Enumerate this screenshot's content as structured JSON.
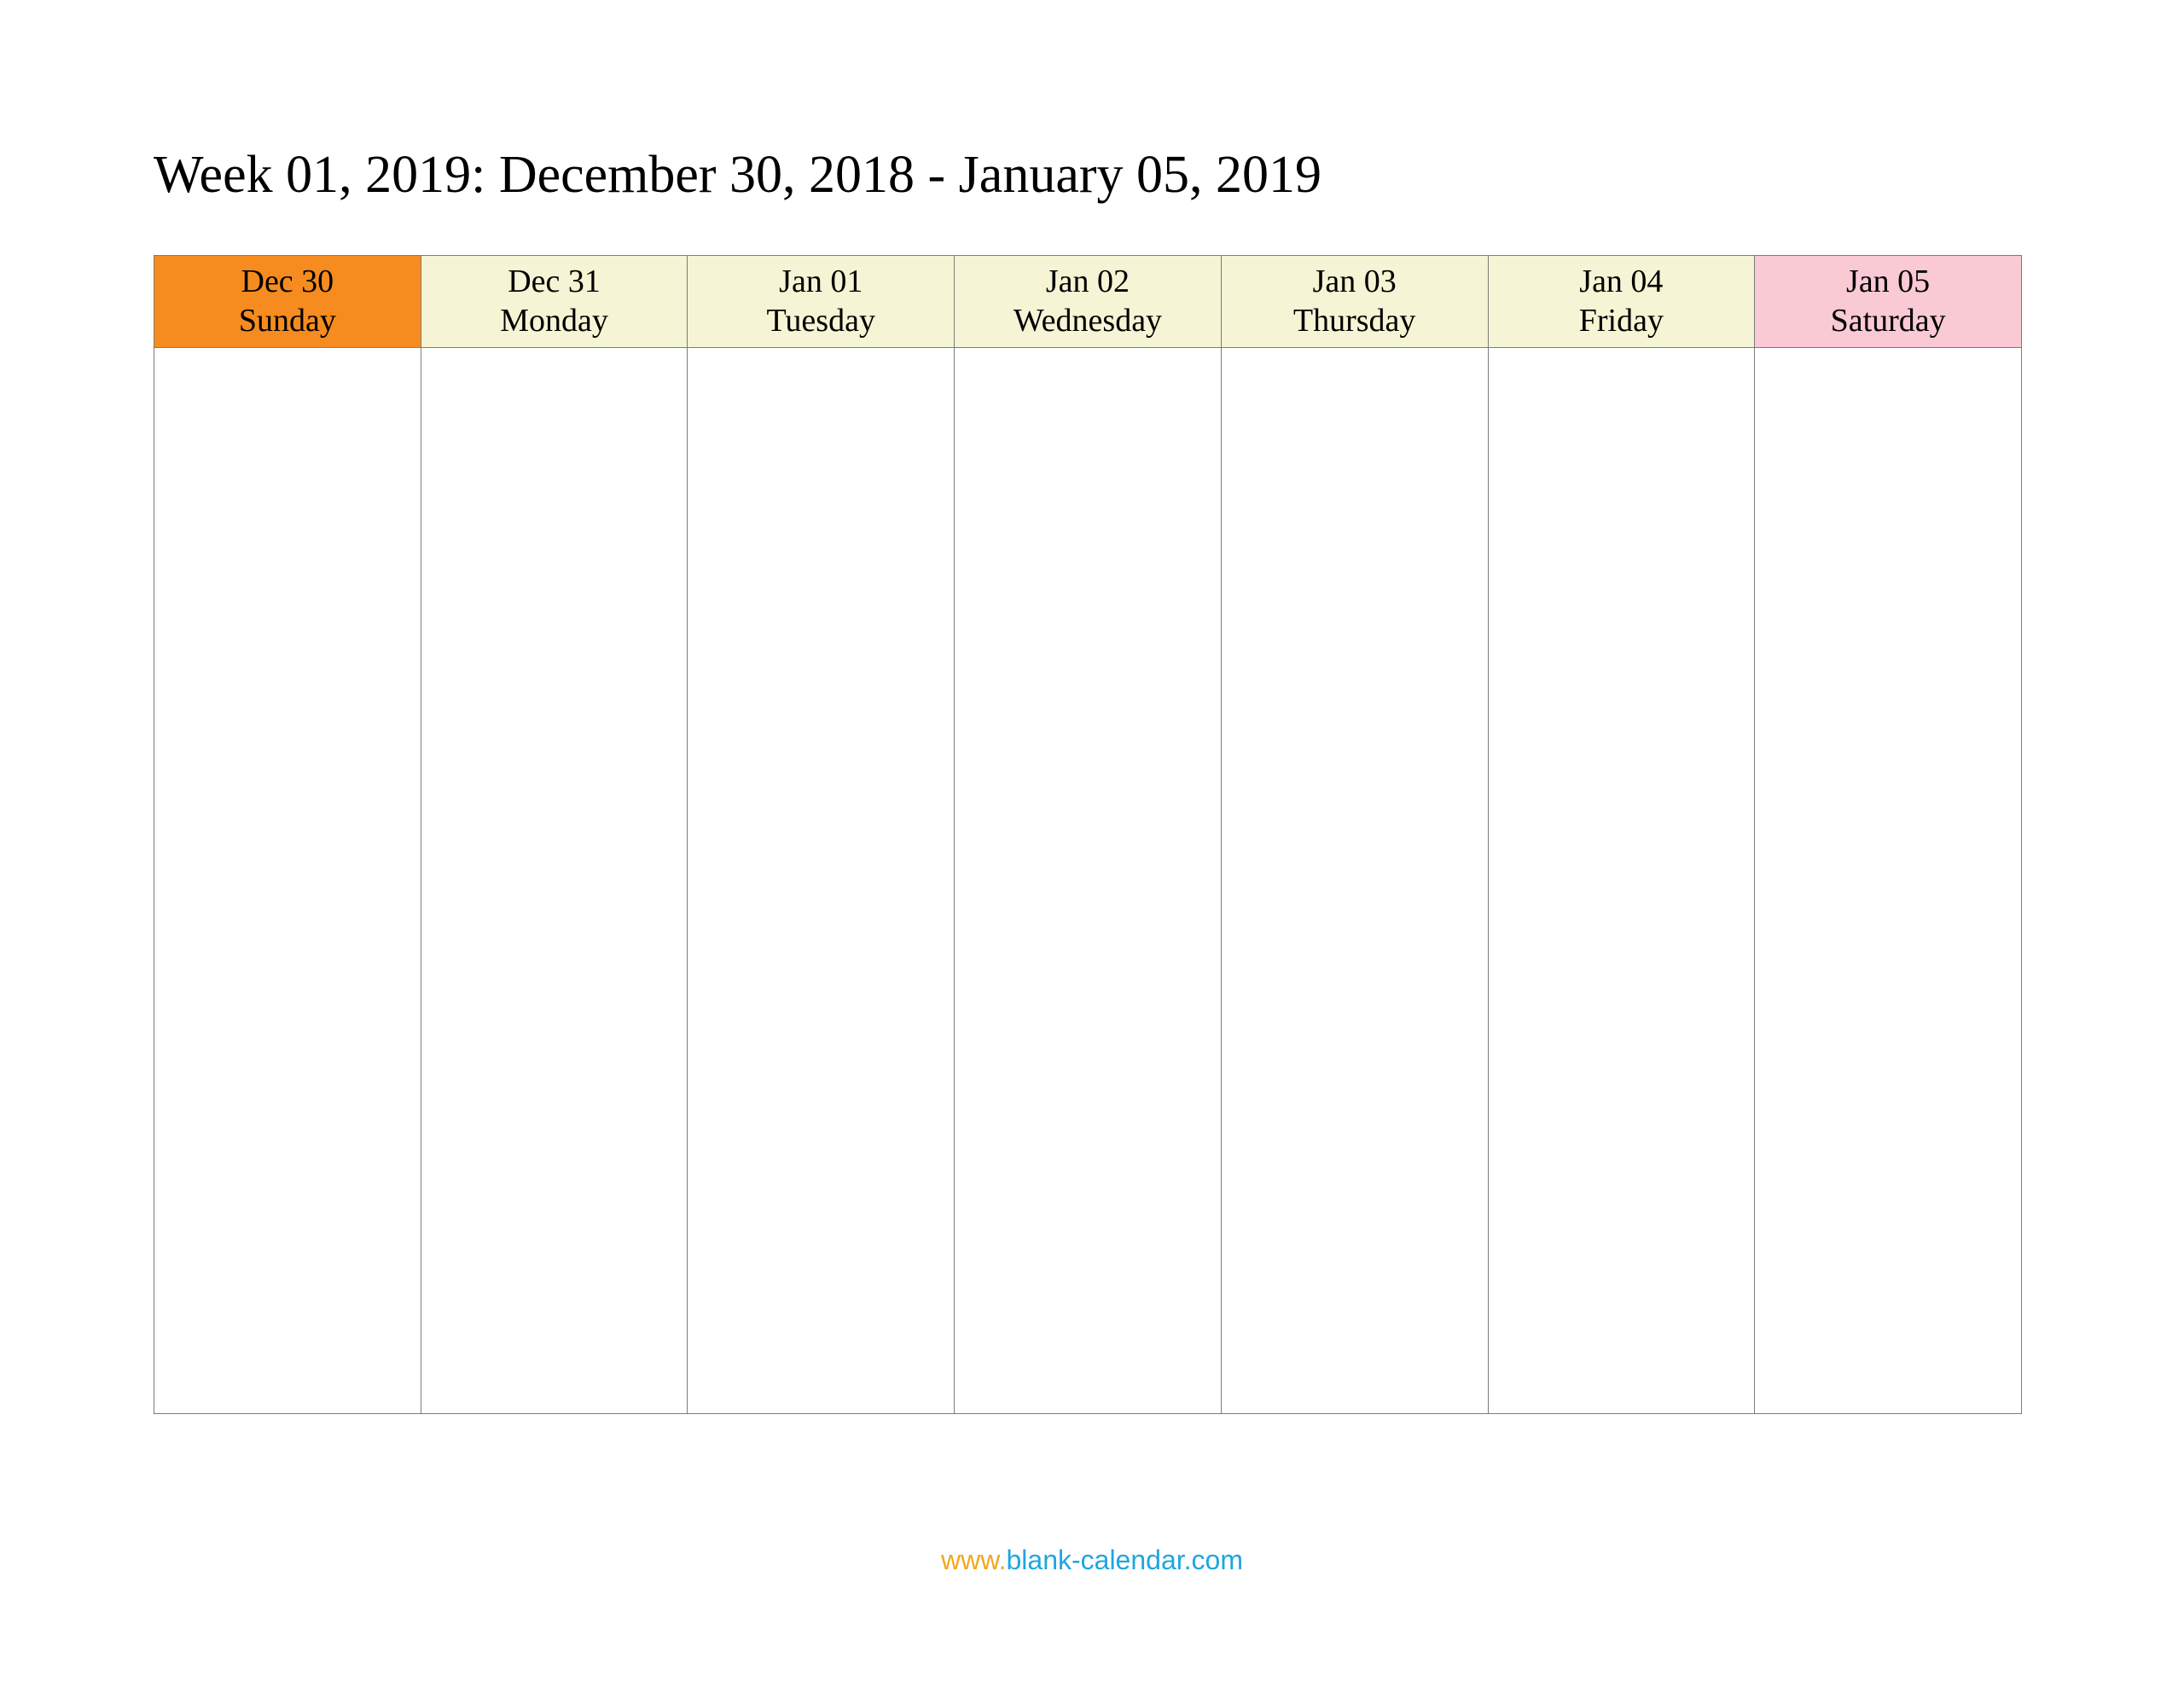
{
  "title": "Week 01, 2019: December 30, 2018 - January 05, 2019",
  "days": [
    {
      "date": "Dec 30",
      "name": "Sunday",
      "kind": "sunday"
    },
    {
      "date": "Dec 31",
      "name": "Monday",
      "kind": "weekday"
    },
    {
      "date": "Jan 01",
      "name": "Tuesday",
      "kind": "weekday"
    },
    {
      "date": "Jan 02",
      "name": "Wednesday",
      "kind": "weekday"
    },
    {
      "date": "Jan 03",
      "name": "Thursday",
      "kind": "weekday"
    },
    {
      "date": "Jan 04",
      "name": "Friday",
      "kind": "weekday"
    },
    {
      "date": "Jan 05",
      "name": "Saturday",
      "kind": "saturday"
    }
  ],
  "footer": {
    "url_prefix": "www.",
    "url_main": "blank-calendar.com"
  }
}
